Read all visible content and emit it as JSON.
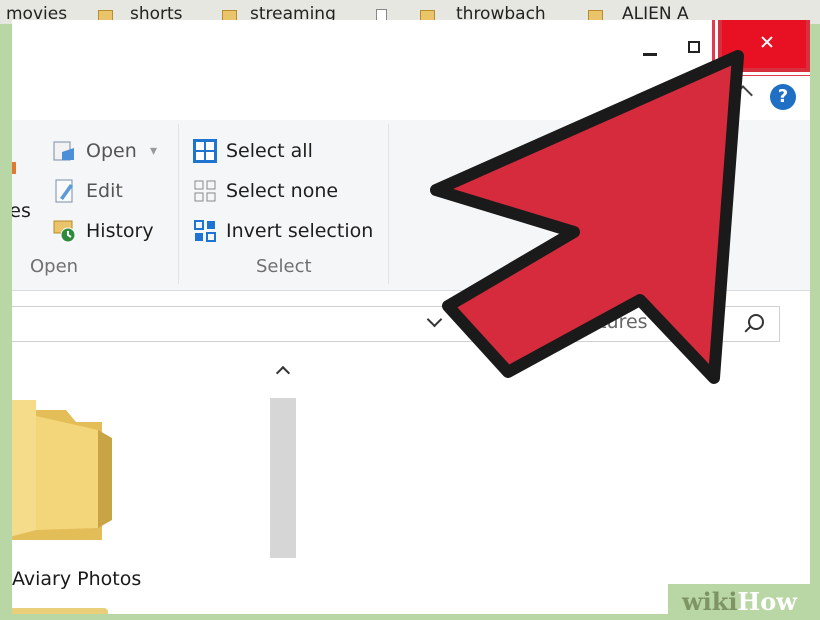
{
  "bookmarks": [
    {
      "label": "movies",
      "icon": "folder-icon"
    },
    {
      "label": "shorts",
      "icon": "folder-icon"
    },
    {
      "label": "streaming",
      "icon": "folder-icon"
    },
    {
      "label": "",
      "icon": "page-icon"
    },
    {
      "label": "throwbach",
      "icon": "folder-icon"
    },
    {
      "label": "ALIEN A",
      "icon": "folder-icon"
    }
  ],
  "ribbon": {
    "partial_label": "ies",
    "open_group": {
      "label": "Open",
      "items": [
        {
          "label": "Open",
          "icon": "open-icon"
        },
        {
          "label": "Edit",
          "icon": "edit-icon"
        },
        {
          "label": "History",
          "icon": "history-icon"
        }
      ]
    },
    "select_group": {
      "label": "Select",
      "items": [
        {
          "label": "Select all",
          "icon": "select-all-icon"
        },
        {
          "label": "Select none",
          "icon": "select-none-icon"
        },
        {
          "label": "Invert selection",
          "icon": "invert-selection-icon"
        }
      ]
    }
  },
  "search": {
    "placeholder": "Search Pictures"
  },
  "help_symbol": "?",
  "folder": {
    "label": "Aviary Photos"
  },
  "watermark": {
    "part1": "wiki",
    "part2": "How"
  },
  "colors": {
    "close": "#e81123",
    "arrow": "#d52b3c",
    "accent": "#1f6fc5"
  }
}
